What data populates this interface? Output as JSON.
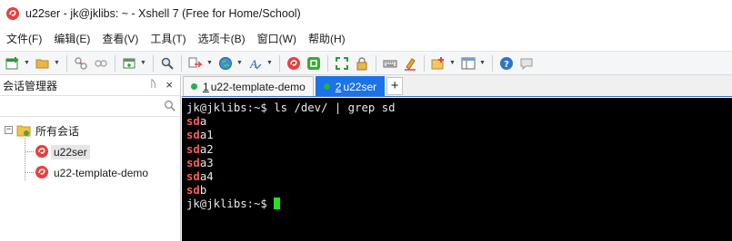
{
  "window": {
    "title": "u22ser - jk@jklibs: ~ - Xshell 7 (Free for Home/School)",
    "app_icon": "xshell-swirl-icon",
    "accent_color": "#1a73e8"
  },
  "menubar": {
    "items": [
      {
        "id": "file",
        "label": "文件(F)"
      },
      {
        "id": "edit",
        "label": "编辑(E)"
      },
      {
        "id": "view",
        "label": "查看(V)"
      },
      {
        "id": "tools",
        "label": "工具(T)"
      },
      {
        "id": "tabs",
        "label": "选项卡(B)"
      },
      {
        "id": "window",
        "label": "窗口(W)"
      },
      {
        "id": "help",
        "label": "帮助(H)"
      }
    ]
  },
  "toolbar": {
    "icons": [
      "new-session-icon",
      "open-folder-icon",
      "reconnect-icon",
      "disconnect-icon",
      "new-window-icon",
      "find-icon",
      "transfer-icon",
      "globe-icon",
      "font-icon",
      "xshell-icon",
      "xftp-icon",
      "fullscreen-icon",
      "lock-icon",
      "keyboard-icon",
      "highlight-icon",
      "compose-icon",
      "layout-icon",
      "help-icon",
      "chat-icon"
    ]
  },
  "sidebar": {
    "title": "会话管理器",
    "pin_glyph": "ᚢ",
    "close_glyph": "×",
    "search_placeholder": "",
    "tree": {
      "root_label": "所有会话",
      "root_toggle": "−",
      "sessions": [
        {
          "label": "u22ser",
          "selected": true
        },
        {
          "label": "u22-template-demo",
          "selected": false
        }
      ]
    }
  },
  "tabs": {
    "items": [
      {
        "index": "1",
        "label": "u22-template-demo",
        "active": false
      },
      {
        "index": "2",
        "label": "u22ser",
        "active": true
      }
    ],
    "add_label": "+"
  },
  "terminal": {
    "prompt": "jk@jklibs:~$",
    "command": " ls /dev/ | grep sd",
    "match": "sd",
    "highlight_color": "#ff5a5a",
    "cursor_color": "#26e026",
    "output": [
      {
        "match": "sd",
        "rest": "a"
      },
      {
        "match": "sd",
        "rest": "a1"
      },
      {
        "match": "sd",
        "rest": "a2"
      },
      {
        "match": "sd",
        "rest": "a3"
      },
      {
        "match": "sd",
        "rest": "a4"
      },
      {
        "match": "sd",
        "rest": "b"
      }
    ],
    "final_prompt": "jk@jklibs:~$ "
  }
}
